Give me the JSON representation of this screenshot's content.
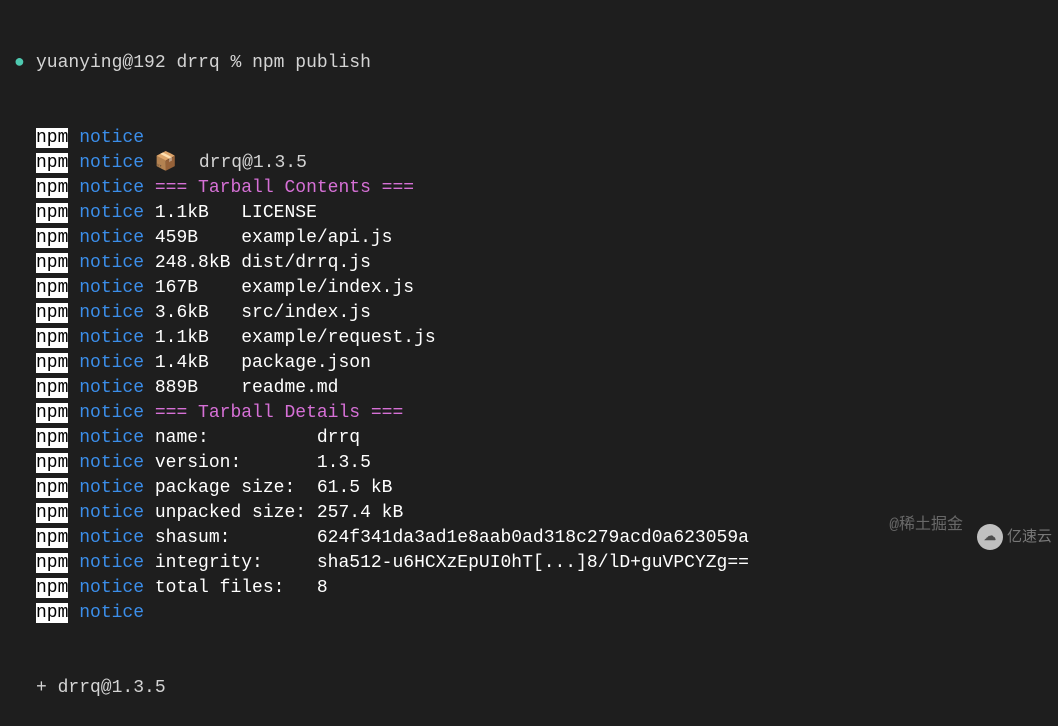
{
  "prompt": {
    "user": "yuanying@192",
    "dir": "drrq",
    "cmd": "npm publish"
  },
  "lines": [
    {
      "prefix": "npm",
      "level": "notice",
      "text": ""
    },
    {
      "prefix": "npm",
      "level": "notice",
      "text": "📦  drrq@1.3.5"
    },
    {
      "prefix": "npm",
      "level": "notice",
      "text": "=== Tarball Contents ===",
      "style": "magenta"
    },
    {
      "prefix": "npm",
      "level": "notice",
      "text": "1.1kB   LICENSE",
      "style": "white"
    },
    {
      "prefix": "npm",
      "level": "notice",
      "text": "459B    example/api.js",
      "style": "white"
    },
    {
      "prefix": "npm",
      "level": "notice",
      "text": "248.8kB dist/drrq.js",
      "style": "white"
    },
    {
      "prefix": "npm",
      "level": "notice",
      "text": "167B    example/index.js",
      "style": "white"
    },
    {
      "prefix": "npm",
      "level": "notice",
      "text": "3.6kB   src/index.js",
      "style": "white"
    },
    {
      "prefix": "npm",
      "level": "notice",
      "text": "1.1kB   example/request.js",
      "style": "white"
    },
    {
      "prefix": "npm",
      "level": "notice",
      "text": "1.4kB   package.json",
      "style": "white"
    },
    {
      "prefix": "npm",
      "level": "notice",
      "text": "889B    readme.md",
      "style": "white"
    },
    {
      "prefix": "npm",
      "level": "notice",
      "text": "=== Tarball Details ===",
      "style": "magenta"
    },
    {
      "prefix": "npm",
      "level": "notice",
      "text": "name:          drrq",
      "style": "white"
    },
    {
      "prefix": "npm",
      "level": "notice",
      "text": "version:       1.3.5",
      "style": "white"
    },
    {
      "prefix": "npm",
      "level": "notice",
      "text": "package size:  61.5 kB",
      "style": "white"
    },
    {
      "prefix": "npm",
      "level": "notice",
      "text": "unpacked size: 257.4 kB",
      "style": "white"
    },
    {
      "prefix": "npm",
      "level": "notice",
      "text": "shasum:        624f341da3ad1e8aab0ad318c279acd0a623059a",
      "style": "white"
    },
    {
      "prefix": "npm",
      "level": "notice",
      "text": "integrity:     sha512-u6HCXzEpUI0hT[...]8/lD+guVPCYZg==",
      "style": "white"
    },
    {
      "prefix": "npm",
      "level": "notice",
      "text": "total files:   8",
      "style": "white"
    },
    {
      "prefix": "npm",
      "level": "notice",
      "text": ""
    }
  ],
  "result": "+ drrq@1.3.5",
  "watermarks": {
    "juejin": "@稀土掘金",
    "yisu": "亿速云"
  }
}
